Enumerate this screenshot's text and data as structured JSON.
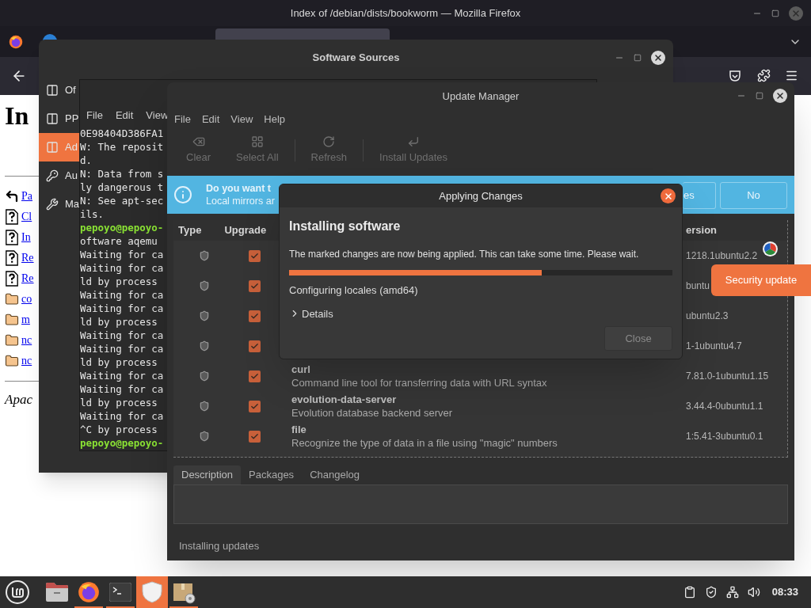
{
  "browser": {
    "title": "Index of /debian/dists/bookworm — Mozilla Firefox",
    "page": {
      "heading": "In",
      "links": [
        {
          "text": "Pa",
          "kind": "back"
        },
        {
          "text": "Cl",
          "kind": "file"
        },
        {
          "text": "In",
          "kind": "file"
        },
        {
          "text": "Re",
          "kind": "file"
        },
        {
          "text": "Re",
          "kind": "file"
        },
        {
          "text": "co",
          "kind": "folder"
        },
        {
          "text": "m",
          "kind": "folder"
        },
        {
          "text": "nc",
          "kind": "folder"
        },
        {
          "text": "nc",
          "kind": "folder"
        }
      ],
      "footer": "Apac"
    }
  },
  "software_sources": {
    "title": "Software Sources",
    "sidebar": [
      {
        "label": "Of",
        "kind": "source",
        "selected": false
      },
      {
        "label": "PP",
        "kind": "source",
        "selected": false
      },
      {
        "label": "Ad",
        "kind": "source",
        "selected": true
      },
      {
        "label": "Au",
        "kind": "key",
        "selected": false
      },
      {
        "label": "Ma",
        "kind": "wrench",
        "selected": false
      }
    ]
  },
  "terminal": {
    "menu": [
      "File",
      "Edit",
      "View"
    ],
    "lines": [
      {
        "text": "0E98404D386FA1",
        "kind": "output"
      },
      {
        "text": "W: The reposit",
        "kind": "output"
      },
      {
        "text": "d.",
        "kind": "output"
      },
      {
        "text": "N: Data from s",
        "kind": "output"
      },
      {
        "text": "ly dangerous t",
        "kind": "output"
      },
      {
        "text": "N: See apt-sec",
        "kind": "output"
      },
      {
        "text": "ils.",
        "kind": "output"
      },
      {
        "text": "pepoyo@pepoyo-",
        "kind": "prompt"
      },
      {
        "text": "oftware aqemu",
        "kind": "output"
      },
      {
        "text": "Waiting for ca",
        "kind": "output"
      },
      {
        "text": "Waiting for ca",
        "kind": "output"
      },
      {
        "text": "ld by process",
        "kind": "output"
      },
      {
        "text": "Waiting for ca",
        "kind": "output"
      },
      {
        "text": "Waiting for ca",
        "kind": "output"
      },
      {
        "text": "ld by process",
        "kind": "output"
      },
      {
        "text": "Waiting for ca",
        "kind": "output"
      },
      {
        "text": "Waiting for ca",
        "kind": "output"
      },
      {
        "text": "ld by process",
        "kind": "output"
      },
      {
        "text": "Waiting for ca",
        "kind": "output"
      },
      {
        "text": "Waiting for ca",
        "kind": "output"
      },
      {
        "text": "ld by process",
        "kind": "output"
      },
      {
        "text": "Waiting for ca",
        "kind": "output"
      },
      {
        "text": "^C by process",
        "kind": "output"
      },
      {
        "text": "pepoyo@pepoyo-",
        "kind": "prompt"
      }
    ]
  },
  "update_manager": {
    "title": "Update Manager",
    "menu": [
      "File",
      "Edit",
      "View",
      "Help"
    ],
    "toolbar": [
      {
        "label": "Clear",
        "kind": "clear",
        "disabled": true
      },
      {
        "label": "Select All",
        "kind": "select_all",
        "disabled": true
      },
      {
        "label": "Refresh",
        "kind": "refresh",
        "disabled": true
      },
      {
        "label": "Install Updates",
        "kind": "install",
        "disabled": true
      }
    ],
    "info_bar": {
      "title": "Do you want t",
      "text": "Local mirrors ar",
      "buttons": [
        "es",
        "No"
      ]
    },
    "columns": [
      "Type",
      "Upgrade",
      "ersion"
    ],
    "rows": [
      {
        "upgrade": true,
        "version": "1218.1ubuntu2.2"
      },
      {
        "upgrade": true,
        "version": "buntu"
      },
      {
        "upgrade": true,
        "version": "ubuntu2.3"
      },
      {
        "upgrade": true,
        "version": "1-1ubuntu4.7"
      },
      {
        "upgrade": true,
        "name": "curl",
        "description": "Command line tool for transferring data with URL syntax",
        "version": "7.81.0-1ubuntu1.15"
      },
      {
        "upgrade": true,
        "name": "evolution-data-server",
        "description": "Evolution database backend server",
        "version": "3.44.4-0ubuntu1.1"
      },
      {
        "upgrade": true,
        "name": "file",
        "description": "Recognize the type of data in a file using \"magic\" numbers",
        "version": "1:5.41-3ubuntu0.1"
      }
    ],
    "tabs": [
      {
        "label": "Description",
        "selected": true
      },
      {
        "label": "Packages",
        "selected": false
      },
      {
        "label": "Changelog",
        "selected": false
      }
    ],
    "status": "Installing updates"
  },
  "dialog": {
    "title": "Applying Changes",
    "heading": "Installing software",
    "message": "The marked changes are now being applied. This can take some time. Please wait.",
    "progress": {
      "level": 0.66
    },
    "step": "Configuring locales (amd64)",
    "details": {
      "label": "Details",
      "expanded": false
    },
    "close_button": {
      "label": "Close",
      "disabled": true
    }
  },
  "tooltip": "Security update",
  "taskbar": {
    "apps": [
      {
        "kind": "files",
        "active": false,
        "running": false
      },
      {
        "kind": "firefox",
        "active": false,
        "running": true
      },
      {
        "kind": "terminal",
        "active": false,
        "running": true
      },
      {
        "kind": "update",
        "active": true,
        "running": false
      },
      {
        "kind": "package",
        "active": false,
        "running": true
      }
    ],
    "clock": "08:33"
  }
}
